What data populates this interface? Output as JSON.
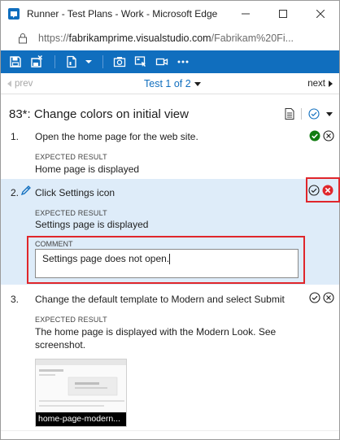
{
  "window": {
    "title": "Runner - Test Plans - Work - Microsoft Edge",
    "minimize_glyph": "—",
    "maximize_glyph": "☐",
    "close_glyph": "✕"
  },
  "address": {
    "url_prefix": "https://",
    "url_host": "fabrikamprime.visualstudio.com",
    "url_path": "/Fabrikam%20Fi..."
  },
  "toolbar": {
    "icons": [
      "save-icon",
      "save-and-close-icon",
      "new-bug-icon",
      "dropdown-icon",
      "capture-screenshot-icon",
      "capture-user-actions-icon",
      "record-screen-icon",
      "more-icon"
    ],
    "color": "#106ebe"
  },
  "pager": {
    "prev_label": "prev",
    "test_label": "Test 1 of 2",
    "next_label": "next"
  },
  "test_case": {
    "title": "83*: Change colors on initial view"
  },
  "steps": [
    {
      "number": "1.",
      "action": "Open the home page for the web site.",
      "expected_label": "EXPECTED RESULT",
      "expected": "Home page is displayed",
      "status": "passed"
    },
    {
      "number": "2.",
      "action": "Click Settings icon",
      "expected_label": "EXPECTED RESULT",
      "expected": "Settings page is displayed",
      "status": "failed",
      "comment_label": "COMMENT",
      "comment": "Settings page does not open."
    },
    {
      "number": "3.",
      "action": "Change the default template to Modern and select Submit",
      "expected_label": "EXPECTED RESULT",
      "expected_line1": "The home page is displayed with the Modern Look. See",
      "expected_line2": "screenshot.",
      "attachment_caption": "home-page-modern...",
      "status": "not-run"
    }
  ],
  "colors": {
    "accent": "#106ebe",
    "pass": "#107c10",
    "fail": "#e0262b",
    "selected_row": "#deecf9"
  }
}
